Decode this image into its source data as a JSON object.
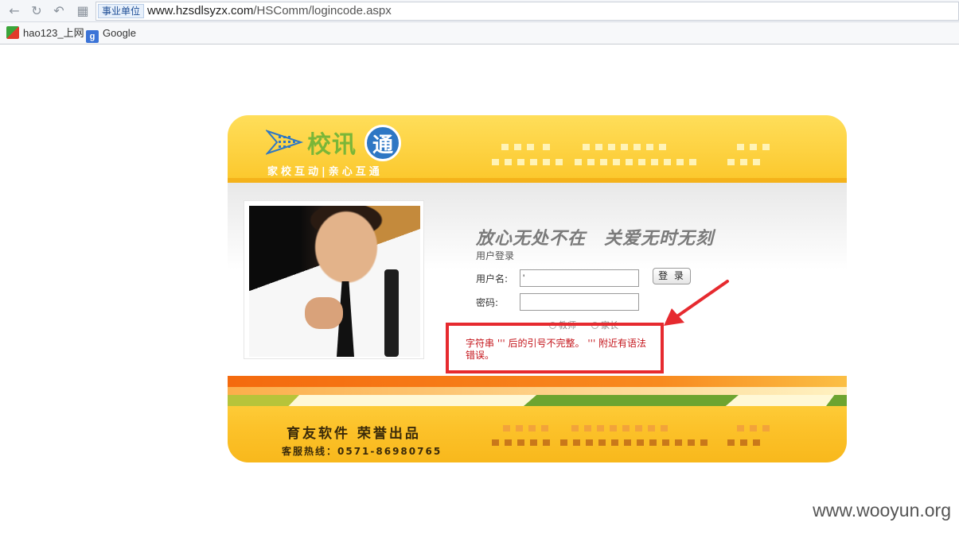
{
  "browser": {
    "url_badge": "事业单位",
    "url_host": "www.hzsdlsyzx.com",
    "url_path": "/HSComm/logincode.aspx",
    "bookmarks": [
      {
        "label": "hao123_上网",
        "icon": "hao123-icon"
      },
      {
        "label": "Google",
        "icon": "google-icon"
      }
    ]
  },
  "header": {
    "brand": "校讯",
    "brand_circle": "通",
    "tagline": "家校互动|亲心互通"
  },
  "main": {
    "slogan": "放心无处不在　关爱无时无刻",
    "login_title": "用户登录",
    "username_label": "用户名:",
    "username_value": "'",
    "password_label": "密码:",
    "password_value": "",
    "login_button": "登 录",
    "role_teacher": "教师",
    "role_parent": "家长",
    "error_message": "字符串 ''' 后的引号不完整。 ''' 附近有语法错误。"
  },
  "footer": {
    "company": "育友软件 荣誉出品",
    "hotline": "客服热线：0571-86980765"
  },
  "watermark": "www.wooyun.org",
  "colors": {
    "header_yellow": "#fbc72b",
    "error_red": "#c4151b",
    "annotation_red": "#e62a2f"
  }
}
